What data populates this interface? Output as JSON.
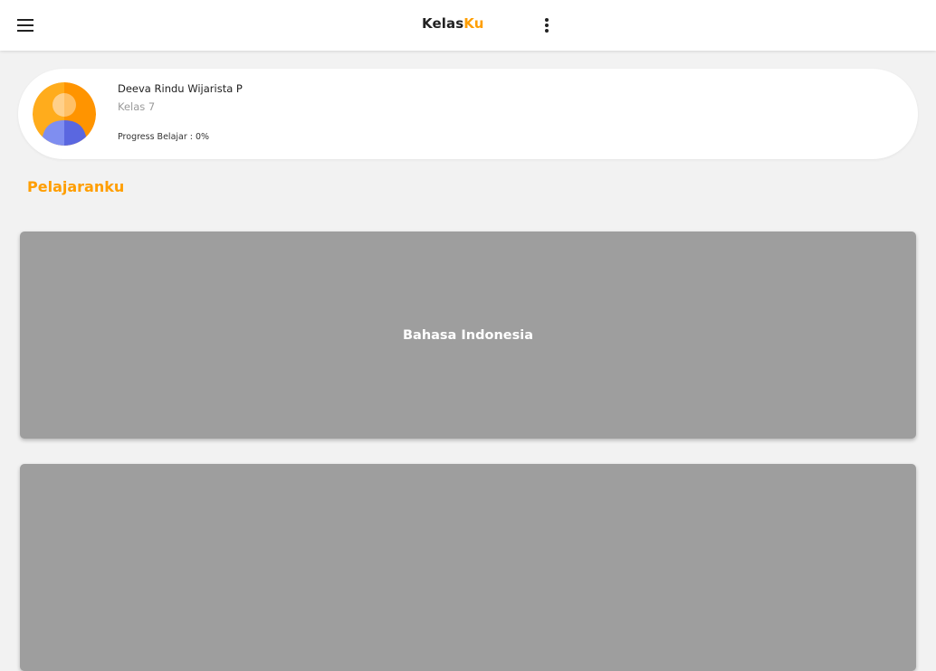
{
  "appbar": {
    "title_part1": "Kelas",
    "title_part2": "Ku",
    "menu_icon": "hamburger-menu-icon",
    "more_icon": "more-vertical-icon",
    "accent_color": "#ff9e00"
  },
  "profile": {
    "name": "Deeva Rindu Wijarista P",
    "class": "Kelas 7",
    "progress_text": "Progress Belajar : 0%",
    "progress_percent": 0,
    "avatar_icon": "user-avatar-icon"
  },
  "section": {
    "title": "Pelajaranku"
  },
  "courses": [
    {
      "title": "Bahasa Indonesia",
      "color": "#9e9e9e"
    },
    {
      "title": "",
      "color": "#9e9e9e"
    }
  ]
}
